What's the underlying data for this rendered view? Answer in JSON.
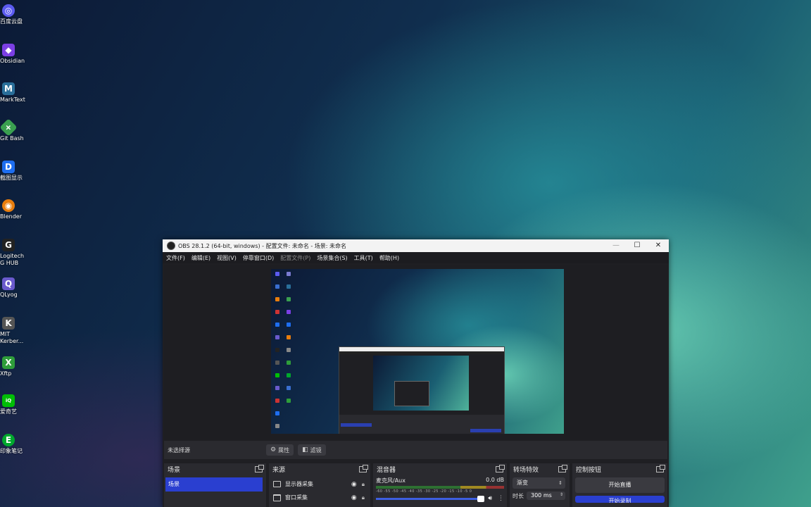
{
  "desktop": {
    "icons": [
      {
        "label": "百度云盘",
        "icon": "cloud-icon",
        "color": "#5b5bf0"
      },
      {
        "label": "Obsidian",
        "icon": "obsidian-icon",
        "color": "#7b3fe4"
      },
      {
        "label": "MarkText",
        "icon": "marktext-icon",
        "color": "#2a6f9a"
      },
      {
        "label": "Git Bash",
        "icon": "gitbash-icon",
        "color": "#3aa050"
      },
      {
        "label": "截图显示",
        "icon": "screenshot-icon",
        "color": "#1e6ef0"
      },
      {
        "label": "Blender",
        "icon": "blender-icon",
        "color": "#e87d0d"
      },
      {
        "label": "Logitech G HUB",
        "icon": "logitech-icon",
        "color": "#222222"
      },
      {
        "label": "QLyog",
        "icon": "qlyog-icon",
        "color": "#6a5acd"
      },
      {
        "label": "MIT Kerber...",
        "icon": "kerberos-icon",
        "color": "#555555"
      },
      {
        "label": "Xftp",
        "icon": "xftp-icon",
        "color": "#2e9d3a"
      },
      {
        "label": "爱奇艺",
        "icon": "iqiyi-icon",
        "color": "#00be06"
      },
      {
        "label": "印象笔记",
        "icon": "evernote-icon",
        "color": "#00a82d"
      }
    ]
  },
  "obs": {
    "title": "OBS 28.1.2 (64-bit, windows) - 配置文件: 未命名 - 场景: 未命名",
    "window_buttons": {
      "minimize": "—",
      "maximize": "☐",
      "close": "✕"
    },
    "menu": [
      {
        "label": "文件(F)",
        "enabled": true
      },
      {
        "label": "编辑(E)",
        "enabled": true
      },
      {
        "label": "视图(V)",
        "enabled": true
      },
      {
        "label": "停靠窗口(D)",
        "enabled": true
      },
      {
        "label": "配置文件(P)",
        "enabled": false
      },
      {
        "label": "场景集合(S)",
        "enabled": true
      },
      {
        "label": "工具(T)",
        "enabled": true
      },
      {
        "label": "帮助(H)",
        "enabled": true
      }
    ],
    "status": {
      "no_source": "未选择源",
      "properties_label": "属性",
      "filters_label": "滤镜"
    },
    "docks": {
      "scenes": {
        "title": "场景",
        "items": [
          "场景"
        ]
      },
      "sources": {
        "title": "来源",
        "items": [
          "显示器采集",
          "窗口采集"
        ]
      },
      "mixer": {
        "title": "混音器",
        "channel": "麦克风/Aux",
        "level": "0.0 dB",
        "ticks": "-60 -55 -50 -45 -40 -35 -30 -25 -20 -15 -10 -5 0"
      },
      "transitions": {
        "title": "转场特效",
        "selected": "渐变",
        "duration_label": "时长",
        "duration_value": "300 ms"
      },
      "controls": {
        "title": "控制按钮",
        "start_stream": "开始直播",
        "start_record": "开始录制"
      }
    }
  }
}
